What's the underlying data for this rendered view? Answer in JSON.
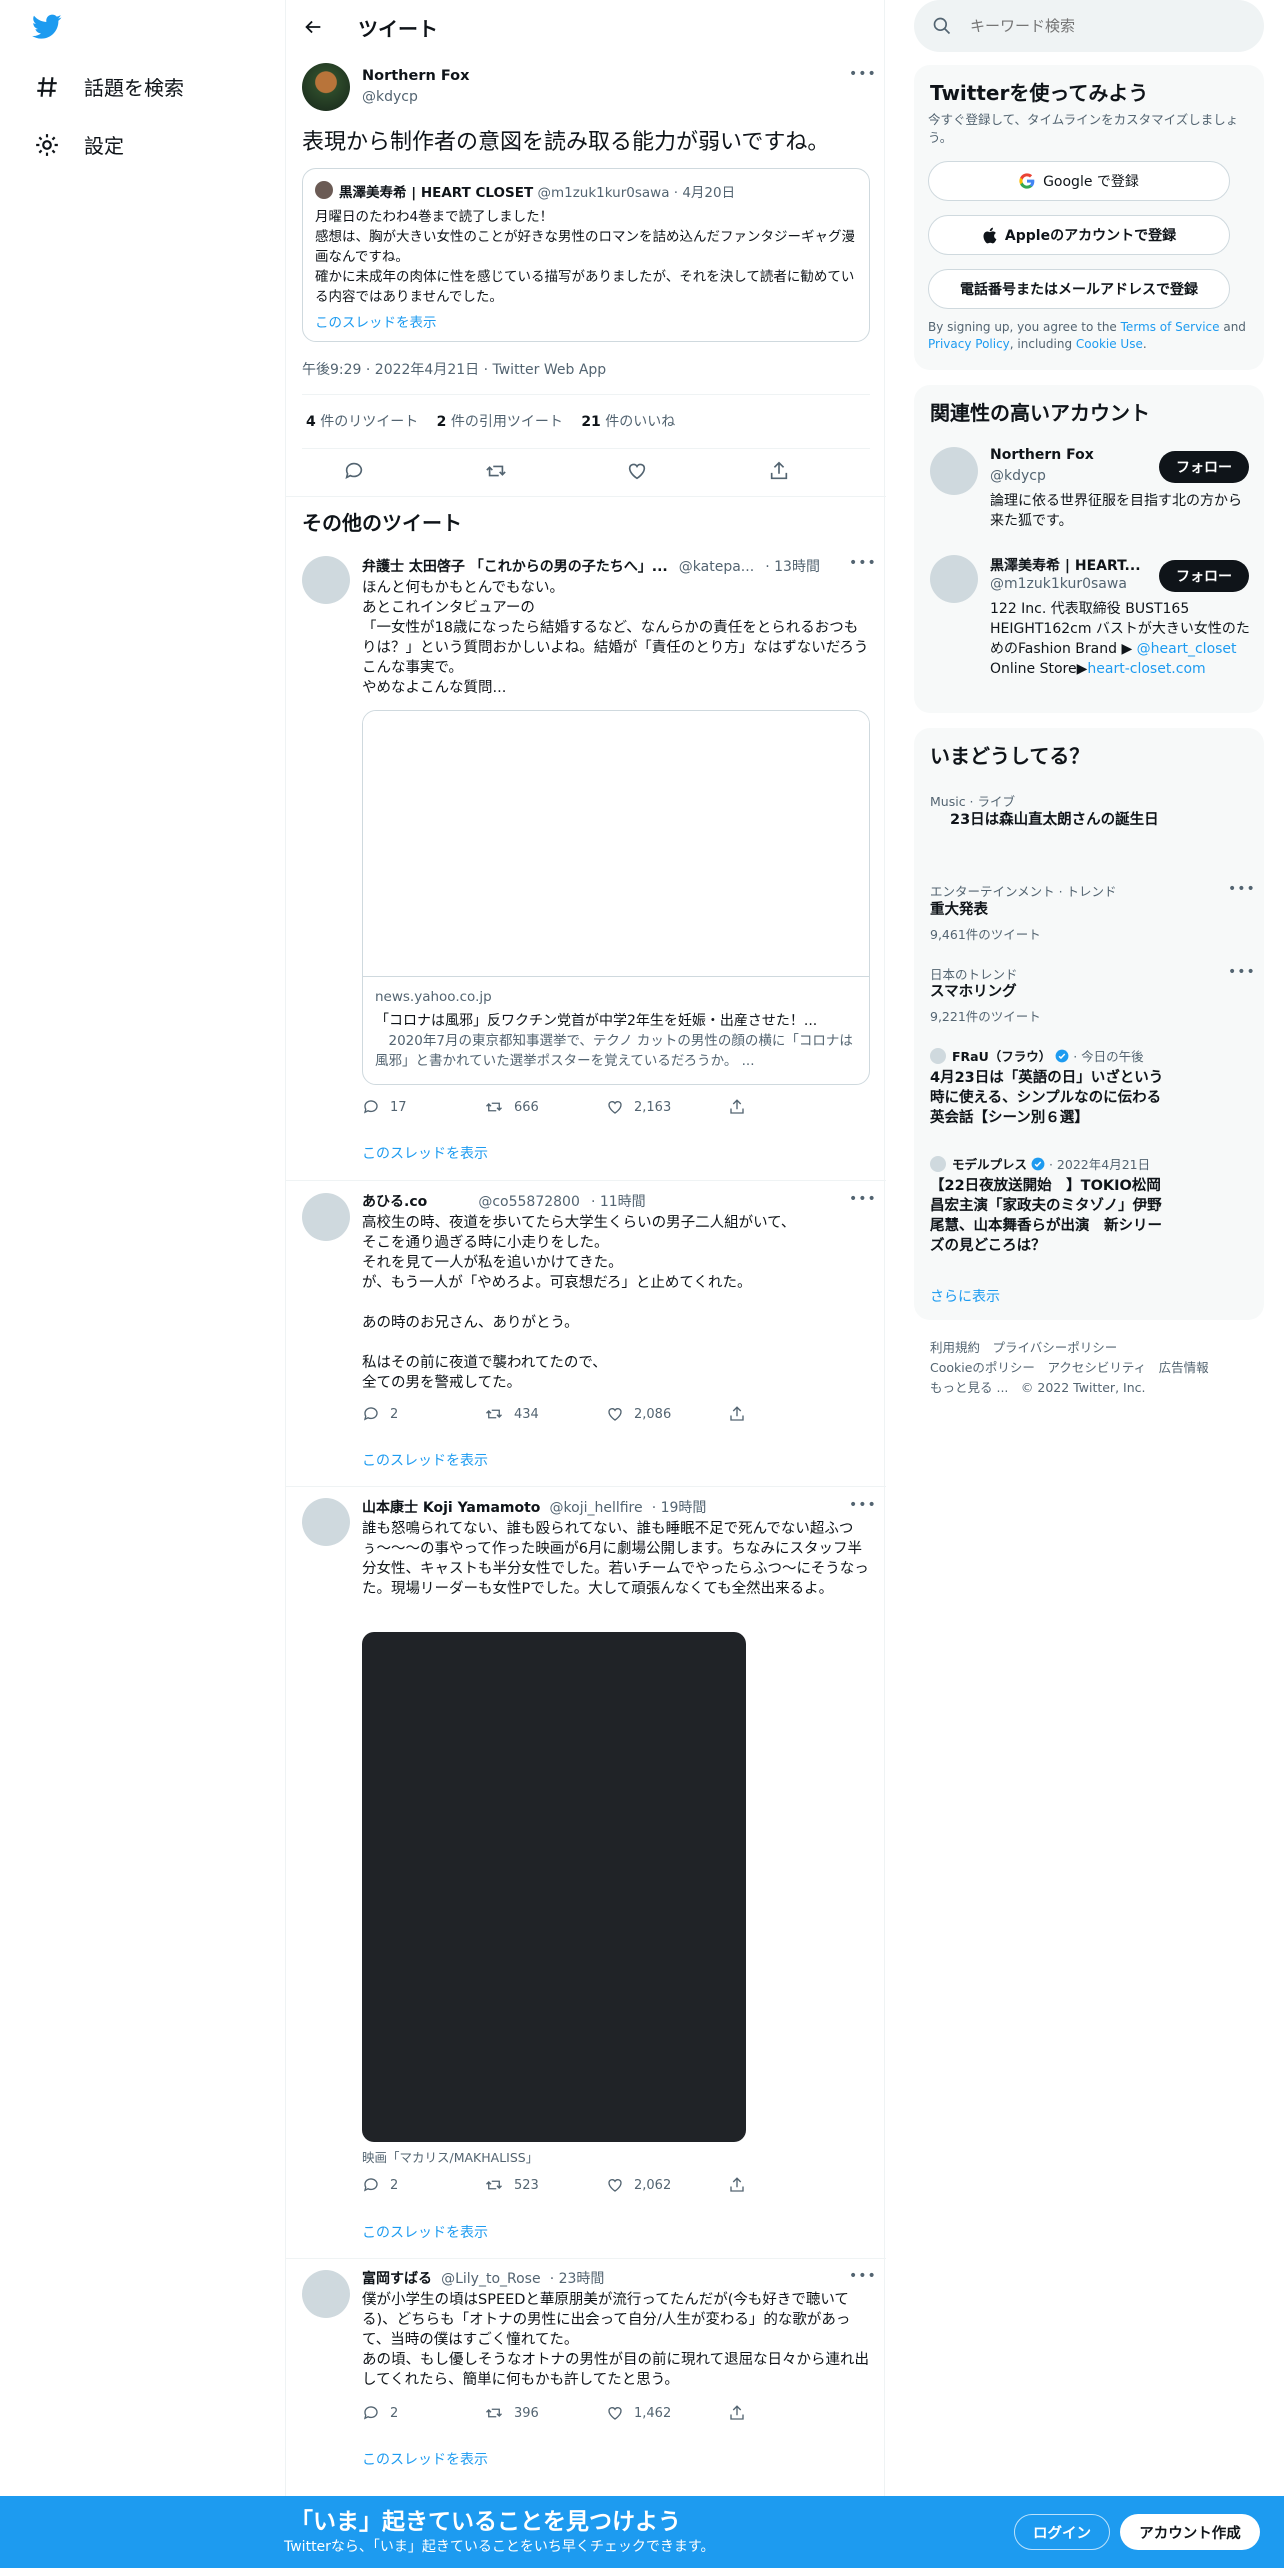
{
  "nav": {
    "explore_label": "話題を検索",
    "settings_label": "設定"
  },
  "header": {
    "title": "ツイート"
  },
  "main_tweet": {
    "name": "Northern Fox",
    "handle": "@kdycp",
    "text": "表現から制作者の意図を読み取る能力が弱いですね。",
    "quote": {
      "name": "黒澤美寿希 | HEART CLOSET",
      "handle": "@m1zuk1kur0sawa",
      "date": "· 4月20日",
      "text": "月曜日のたわわ4巻まで読了しました！\n感想は、胸が大きい女性のことが好きな男性のロマンを詰め込んだファンタジーギャグ漫画なんですね。\n確かに未成年の肉体に性を感じている描写がありましたが、それを決して読者に勧めている内容ではありませんでした。",
      "thread_link": "このスレッドを表示"
    },
    "timestamp": "午後9:29 · 2022年4月21日 · Twitter Web App",
    "stats": {
      "retweets_count": "4",
      "retweets_label": " 件のリツイート",
      "quotes_count": "2",
      "quotes_label": " 件の引用ツイート",
      "likes_count": "21",
      "likes_label": " 件のいいね"
    }
  },
  "more_tweets_heading": "その他のツイート",
  "tweets": [
    {
      "name": "弁護士 太田啓子 「これからの男の子たちへ」...",
      "handle": "@katepa...",
      "time": "· 13時間",
      "text": "ほんと何もかもとんでもない。\nあとこれインタビュアーの\n「一女性が18歳になったら結婚するなど、なんらかの責任をとられるおつもりは？」という質問おかしいよね。結婚が「責任のとり方」なはずないだろうこんな事実で。\nやめなよこんな質問...",
      "card": {
        "domain": "news.yahoo.co.jp",
        "title": "「コロナは風邪」反ワクチン党首が中学2年生を妊娠・出産させた！...",
        "desc": "2020年7月の東京都知事選挙で、テクノ カットの男性の顔の横に「コロナは風邪」と書かれていた選挙ポスターを覚えているだろうか。 ..."
      },
      "replies": "17",
      "retweets": "666",
      "likes": "2,163",
      "thread_link": "このスレッドを表示"
    },
    {
      "name": "あひる.co",
      "handle": "@co55872800",
      "time": "· 11時間",
      "text": "高校生の時、夜道を歩いてたら大学生くらいの男子二人組がいて、\nそこを通り過ぎる時に小走りをした。\nそれを見て一人が私を追いかけてきた。\nが、もう一人が「やめろよ。可哀想だろ」と止めてくれた。\n\nあの時のお兄さん、ありがとう。\n\n私はその前に夜道で襲われてたので、\n全ての男を警戒してた。",
      "replies": "2",
      "retweets": "434",
      "likes": "2,086",
      "thread_link": "このスレッドを表示"
    },
    {
      "name": "山本康士 Koji Yamamoto",
      "handle": "@koji_hellfire",
      "time": "· 19時間",
      "text": "誰も怒鳴られてない、誰も殴られてない、誰も睡眠不足で死んでない超ふつぅ〜〜〜の事やって作った映画が6月に劇場公開します。ちなみにスタッフ半分女性、キャストも半分女性でした。若いチームでやったらふつ〜にそうなった。現場リーダーも女性Pでした。大して頑張んなくても全然出来るよ。",
      "media_caption": "映画「マカリス/MAKHALISS」",
      "replies": "2",
      "retweets": "523",
      "likes": "2,062",
      "thread_link": "このスレッドを表示"
    },
    {
      "name": "富岡すばる",
      "handle": "@Lily_to_Rose",
      "time": "· 23時間",
      "text": "僕が小学生の頃はSPEEDと華原朋美が流行ってたんだが(今も好きで聴いてる)、どちらも「オトナの男性に出会って自分/人生が変わる」的な歌があって、当時の僕はすごく憧れてた。\nあの頃、もし優しそうなオトナの男性が目の前に現れて退屈な日々から連れ出してくれたら、簡単に何もかも許してたと思う。",
      "replies": "2",
      "retweets": "396",
      "likes": "1,462",
      "thread_link": "このスレッドを表示"
    }
  ],
  "search": {
    "placeholder": "キーワード検索"
  },
  "signup": {
    "title": "Twitterを使ってみよう",
    "subtitle": "今すぐ登録して、タイムラインをカスタマイズしましょう。",
    "google_label": "Google で登録",
    "apple_label": "Appleのアカウントで登録",
    "phone_label": "電話番号またはメールアドレスで登録",
    "legal_pre": "By signing up, you agree to the ",
    "legal_terms": "Terms of Service",
    "legal_and": " and ",
    "legal_privacy": "Privacy Policy",
    "legal_including": ", including ",
    "legal_cookie": "Cookie Use",
    "legal_end": "."
  },
  "relevant": {
    "title": "関連性の高いアカウント",
    "accounts": [
      {
        "name": "Northern Fox",
        "handle": "@kdycp",
        "bio": "論理に依る世界征服を目指す北の方から来た狐です。",
        "follow": "フォロー"
      },
      {
        "name": "黒澤美寿希 | HEART...",
        "handle": "@m1zuk1kur0sawa",
        "bio_pre": "122 Inc. 代表取締役 BUST165 HEIGHT162cm バストが大きい女性のためのFashion Brand ▶ ",
        "bio_link1": "@heart_closet",
        "bio_mid": " Online Store▶",
        "bio_link2": "heart-closet.com",
        "follow": "フォロー"
      }
    ]
  },
  "trends": {
    "title": "いまどうしてる？",
    "items": [
      {
        "category": "Music · ライブ",
        "title": "23日は森山直太朗さんの誕生日"
      },
      {
        "category": "エンターテインメント · トレンド",
        "title": "重大発表",
        "count": "9,461件のツイート"
      },
      {
        "category": "日本のトレンド",
        "title": "スマホリング",
        "count": "9,221件のツイート"
      },
      {
        "source": "FRaU（フラウ）",
        "time": "· 今日の午後",
        "title": "4月23日は「英語の日」いざという時に使える、シンプルなのに伝わる英会話【シーン別６選】"
      },
      {
        "source": "モデルプレス",
        "time": "· 2022年4月21日",
        "title": "【22日夜放送開始　】TOKIO松岡昌宏主演「家政夫のミタゾノ」伊野尾慧、山本舞香らが出演　新シリーズの見どころは？"
      }
    ],
    "show_more": "さらに表示"
  },
  "footer": {
    "terms": "利用規約",
    "privacy": "プライバシーポリシー",
    "cookie": "Cookieのポリシー",
    "accessibility": "アクセシビリティ",
    "ads": "広告情報",
    "more": "もっと見る ...",
    "copyright": "© 2022 Twitter, Inc."
  },
  "bottom_bar": {
    "title": "「いま」起きていることを見つけよう",
    "subtitle": "Twitterなら、「いま」起きていることをいち早くチェックできます。",
    "login": "ログイン",
    "signup": "アカウント作成"
  },
  "colors": {
    "accent": "#1d9bf0",
    "text": "#0f1419",
    "muted": "#536471",
    "panel": "#f7f9f9"
  }
}
